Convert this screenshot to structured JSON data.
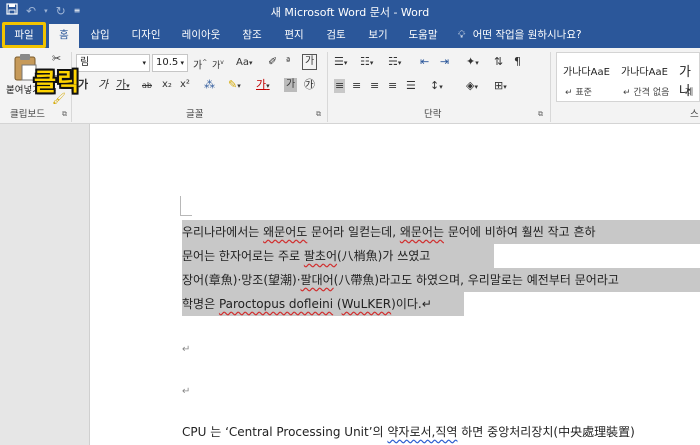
{
  "titlebar": {
    "title": "새 Microsoft Word 문서 - Word",
    "save_icon": "save-icon",
    "undo_icon": "undo-icon",
    "redo_icon": "redo-icon",
    "customize_icon": "customize-qat-icon"
  },
  "tabs": [
    "파일",
    "홈",
    "삽입",
    "디자인",
    "레이아웃",
    "참조",
    "편지",
    "검토",
    "보기",
    "도움말"
  ],
  "tell_me": "어떤 작업을 원하시나요?",
  "ribbon": {
    "clipboard": {
      "paste_label": "붙여넣기",
      "group_label": "클립보드"
    },
    "font": {
      "font_name": "림",
      "font_size": "10.5",
      "group_label": "글꼴",
      "buttons": [
        "가",
        "가",
        "Aa",
        "가",
        "가",
        "가",
        "가",
        "가",
        "ab",
        "x₂",
        "x²"
      ]
    },
    "paragraph": {
      "group_label": "단락"
    },
    "styles": {
      "samples": [
        "가나다AaE",
        "가나다AaE",
        "가나"
      ],
      "names": [
        "↵ 표준",
        "↵ 간격 없음",
        "제"
      ],
      "group_label": "스"
    }
  },
  "annotation": {
    "text": "클릭"
  },
  "document": {
    "lines": [
      [
        "우리나라에서는 ",
        "왜문어도",
        " 문어라 일컫는데, ",
        "왜문어는",
        " 문어에 비하여 훨씬 작고 흔하"
      ],
      [
        "문어는 한자어로는 주로 ",
        "팔초어",
        "(八梢魚)가 쓰였고"
      ],
      [
        "장어(章魚)·망조(望潮)·",
        "팔대어",
        "(八帶魚)라고도 하였으며, 우리말로는 예전부터 문어라고"
      ],
      [
        "학명은 ",
        "Paroctopus dofleini",
        " (",
        "WuLKER",
        ")이다.↵"
      ]
    ],
    "marks": [
      "↵",
      "↵"
    ],
    "cpu_line": [
      "CPU 는 ‘Central Processing Unit’의 ",
      "약자로서,직역",
      " 하면 중앙처리장치(中央處理裝置)"
    ]
  }
}
